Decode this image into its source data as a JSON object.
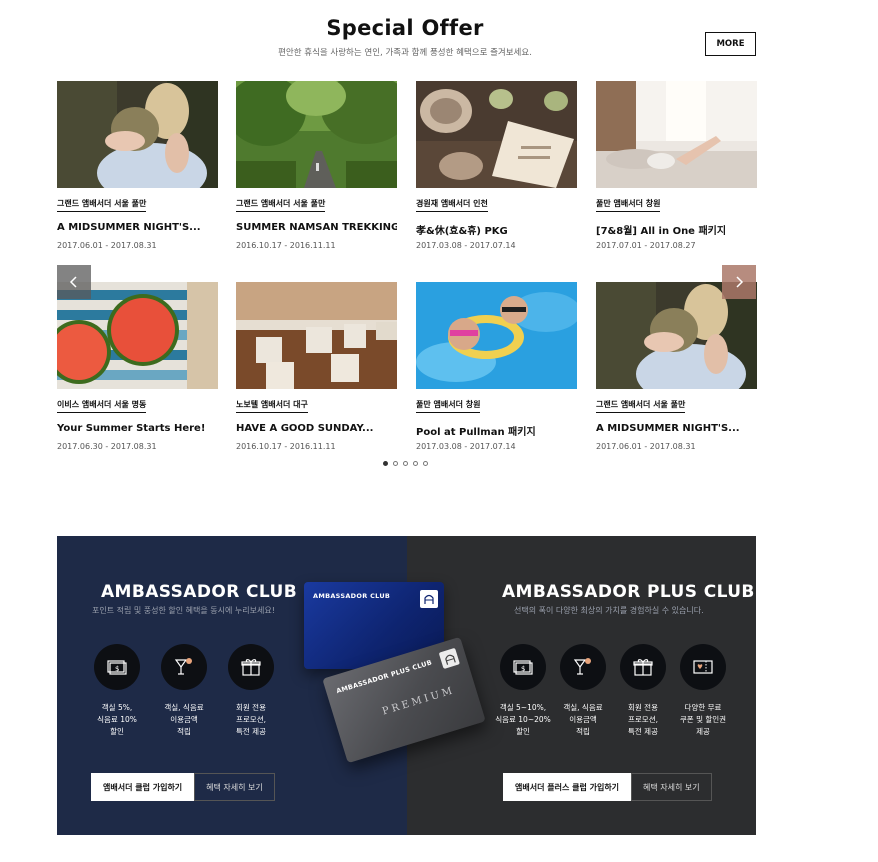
{
  "special_offer": {
    "title": "Special Offer",
    "subtitle": "편안한 휴식을 사랑하는 연인, 가족과 함께 풍성한 혜택으로 즐겨보세요.",
    "more_label": "MORE"
  },
  "offers": [
    {
      "tag": "그랜드 앰배서더 서울 풀만",
      "title": "A MIDSUMMER NIGHT'S...",
      "dates": "2017.06.01 - 2017.08.31",
      "image": "woman-sitting-photo"
    },
    {
      "tag": "그랜드 앰배서더 서울 풀만",
      "title": "SUMMER NAMSAN TREKKING...",
      "dates": "2016.10.17 - 2016.11.11",
      "image": "forest-road-photo"
    },
    {
      "tag": "경원재 앰배서더 인천",
      "title": "孝&休(효&휴) PKG",
      "dates": "2017.03.08 - 2017.07.14",
      "image": "tea-set-photo"
    },
    {
      "tag": "풀만 앰배서더 창원",
      "title": "[7&8월] All in One 패키지",
      "dates": "2017.07.01 - 2017.08.27",
      "image": "bed-relax-photo"
    },
    {
      "tag": "이비스 앰배서더 서울 명동",
      "title": "Your Summer Starts Here!",
      "dates": "2017.06.30 - 2017.08.31",
      "image": "watermelon-photo"
    },
    {
      "tag": "노보텔 앰배서더 대구",
      "title": "HAVE A GOOD SUNDAY...",
      "dates": "2016.10.17 - 2016.11.11",
      "image": "cups-photo"
    },
    {
      "tag": "풀만 앰배서더 창원",
      "title": "Pool at Pullman 패키지",
      "dates": "2017.03.08 - 2017.07.14",
      "image": "pool-kids-photo"
    },
    {
      "tag": "그랜드 앰배서더 서울 풀만",
      "title": "A MIDSUMMER NIGHT'S...",
      "dates": "2017.06.01 - 2017.08.31",
      "image": "woman-sitting-photo"
    }
  ],
  "carousel": {
    "dot_count": 5,
    "active_index": 0,
    "prev_icon": "chevron-left-icon",
    "next_icon": "chevron-right-icon"
  },
  "ambassador_club": {
    "title": "AMBASSADOR CLUB",
    "subtitle": "포인트 적립 및 풍성한 할인 혜택을 동시에 누리보세요!",
    "benefits": [
      {
        "icon": "money-icon",
        "label": "객실 5%,\n식음료 10%\n할인"
      },
      {
        "icon": "drink-icon",
        "label": "객실, 식음료\n이용금액\n적립"
      },
      {
        "icon": "gift-icon",
        "label": "회원 전용\n프로모션,\n특전 제공"
      }
    ],
    "join_label": "앰배서더 클럽 가입하기",
    "details_label": "혜택 자세히 보기"
  },
  "ambassador_plus_club": {
    "title": "AMBASSADOR PLUS CLUB",
    "subtitle": "선택의 폭이 다양한 최상의 가치를 경험하실 수 있습니다.",
    "benefits": [
      {
        "icon": "money-icon",
        "label": "객실 5~10%,\n식음료 10~20%\n할인"
      },
      {
        "icon": "drink-icon",
        "label": "객실, 식음료\n이용금액\n적립"
      },
      {
        "icon": "gift-icon",
        "label": "회원 전용\n프로모션,\n특전 제공"
      },
      {
        "icon": "coupon-icon",
        "label": "다양한 무료\n쿠폰 및 할인권\n제공"
      }
    ],
    "join_label": "앰배서더 플러스 클럽 가입하기",
    "details_label": "혜택 자세히 보기"
  },
  "member_cards": {
    "blue_card_name": "AMBASSADOR CLUB",
    "gray_card_name": "AMBASSADOR PLUS CLUB",
    "gray_card_word": "PREMIUM"
  },
  "colors": {
    "club_left_bg": "#1e2a47",
    "club_right_bg": "#2c2d2f",
    "icon_circle": "#0d0f13",
    "arrow_right": "#aa7869"
  }
}
